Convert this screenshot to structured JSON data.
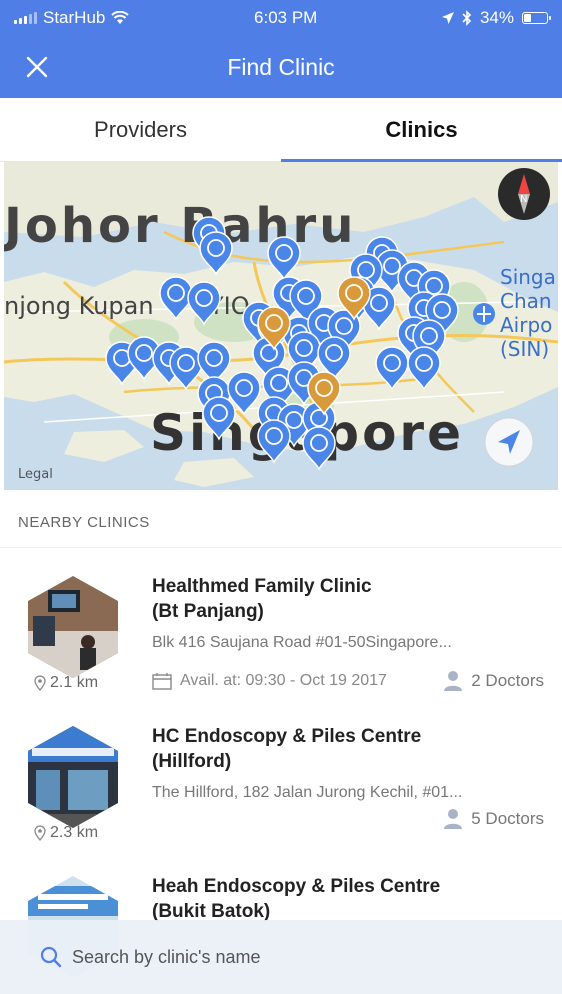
{
  "status": {
    "carrier": "StarHub",
    "time": "6:03 PM",
    "battery": "34%"
  },
  "header": {
    "title": "Find Clinic"
  },
  "tabs": [
    {
      "label": "Providers",
      "active": false
    },
    {
      "label": "Clinics",
      "active": true
    }
  ],
  "map": {
    "city_labels": [
      "Johor Bahru",
      "Singapore",
      "Singa",
      "Chan",
      "Airpo",
      "(SIN)"
    ],
    "partial_labels": [
      "njong Kupan",
      "YIO",
      "Legal"
    ]
  },
  "nearby": {
    "heading": "NEARBY CLINICS",
    "clinics": [
      {
        "name_line1": "Healthmed Family Clinic",
        "name_line2": "(Bt Panjang)",
        "address": "Blk 416 Saujana Road #01-50Singapore...",
        "distance": "2.1 km",
        "availability": "Avail. at: 09:30 - Oct 19 2017",
        "doctors": "2 Doctors"
      },
      {
        "name_line1": "HC Endoscopy & Piles Centre",
        "name_line2": "(Hillford)",
        "address": "The Hillford, 182 Jalan Jurong Kechil, #01...",
        "distance": "2.3 km",
        "availability": "",
        "doctors": "5 Doctors"
      },
      {
        "name_line1": "Heah Endoscopy & Piles Centre",
        "name_line2": "(Bukit Batok)",
        "address": "",
        "distance": "",
        "availability": "",
        "doctors": ""
      }
    ]
  },
  "search": {
    "placeholder": "Search by clinic's name"
  },
  "colors": {
    "primary": "#4f7fe6",
    "pin_blue": "#4a86e8",
    "pin_dental": "#d99a3c"
  }
}
